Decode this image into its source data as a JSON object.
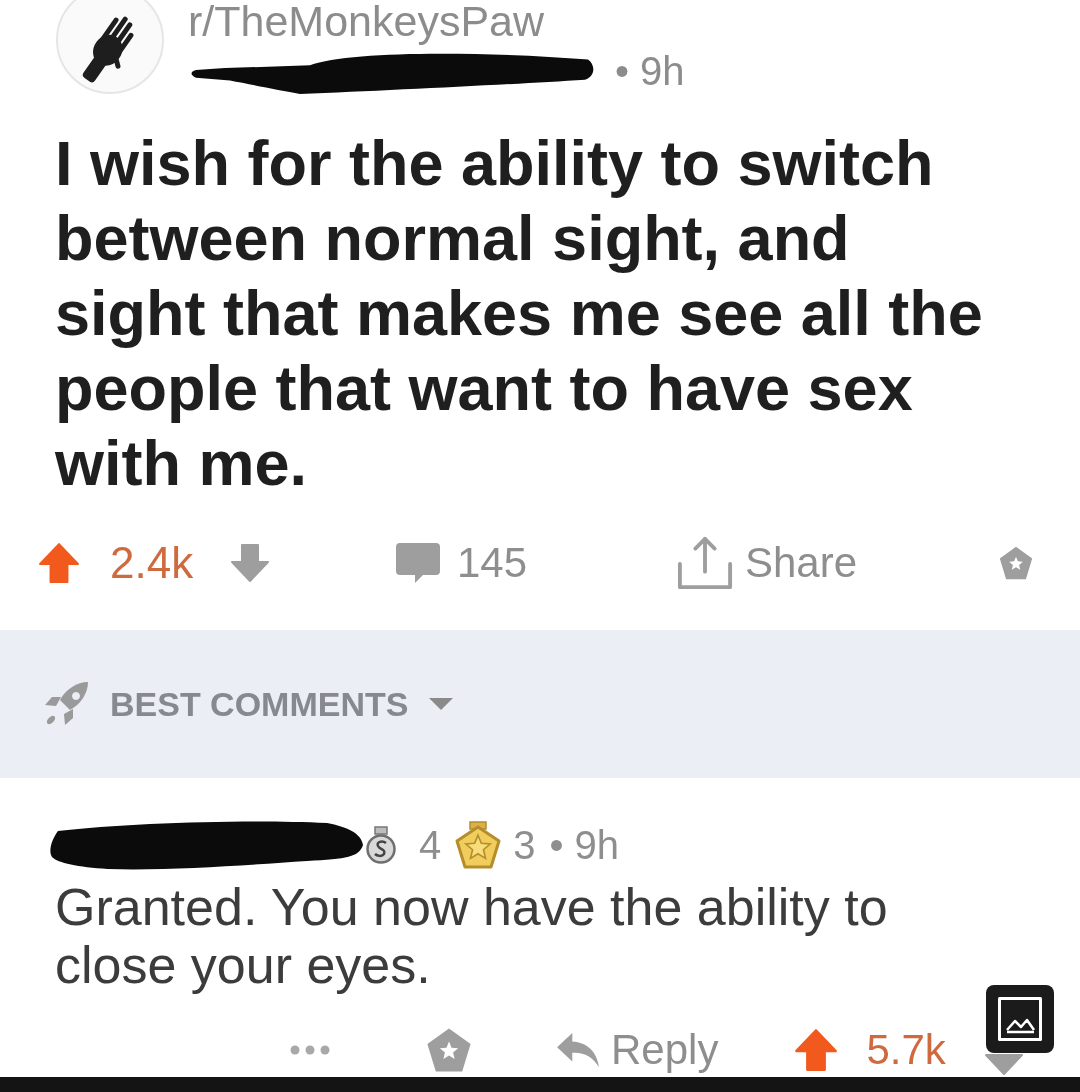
{
  "post": {
    "subreddit": "r/TheMonkeysPaw",
    "author": {
      "redacted": true
    },
    "age": "• 9h",
    "title": "I wish for the ability to switch between normal sight, and sight that makes me see all the people that want to have sex with me.",
    "upvoted": true,
    "downvoted": false,
    "score": "2.4k",
    "comment_count": "145",
    "share_label": "Share"
  },
  "comments_sort": {
    "label": "BEST COMMENTS"
  },
  "comment": {
    "author": {
      "redacted": true
    },
    "awards": [
      {
        "kind": "silver",
        "count": "4"
      },
      {
        "kind": "gold",
        "count": "3"
      }
    ],
    "age": "• 9h",
    "body": "Granted. You now have the ability to close your eyes.",
    "reply_label": "Reply",
    "upvoted": true,
    "downvoted": false,
    "score": "5.7k"
  }
}
